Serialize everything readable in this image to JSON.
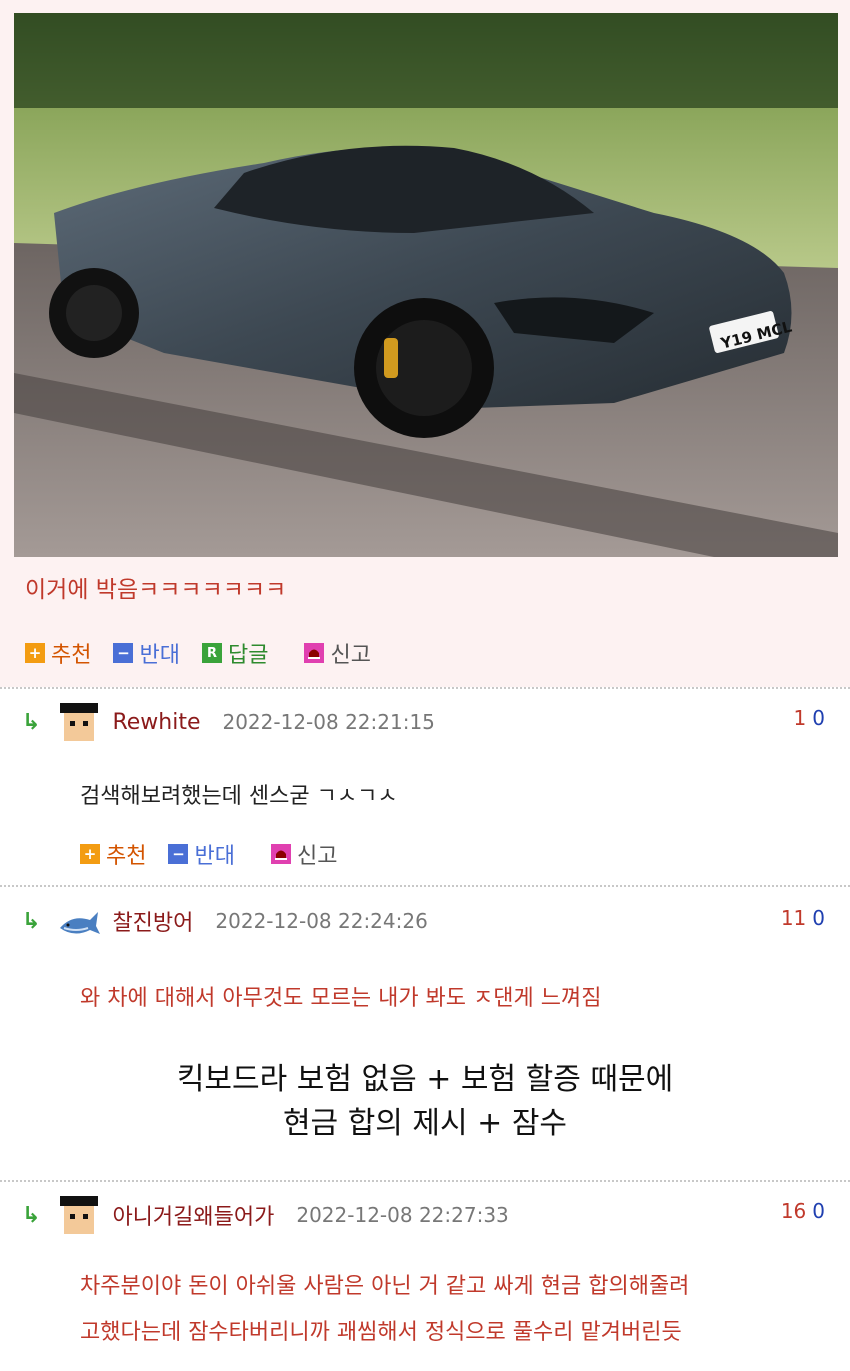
{
  "post": {
    "image_label": "McLaren 720S sports car photo",
    "plate_text": "Y19 MCL",
    "text": "이거에 박음ㅋㅋㅋㅋㅋㅋㅋ",
    "actions": {
      "up": "추천",
      "down": "반대",
      "reply": "답글",
      "report": "신고",
      "reply_badge": "R"
    }
  },
  "comments": [
    {
      "nick": "Rewhite",
      "date": "2022-12-08 22:21:15",
      "up": "1",
      "down": "0",
      "text": "검색해보려했는데 센스굳 ㄱㅅㄱㅅ",
      "actions": {
        "up": "추천",
        "down": "반대",
        "report": "신고"
      }
    },
    {
      "nick": "찰진방어",
      "date": "2022-12-08 22:24:26",
      "up": "11",
      "down": "0",
      "text": "와 차에 대해서 아무것도 모르는 내가 봐도 ㅈ댄게 느껴짐"
    },
    {
      "nick": "아니거길왜들어가",
      "date": "2022-12-08 22:27:33",
      "up": "16",
      "down": "0",
      "text_line1": "차주분이야 돈이 아쉬울 사람은 아닌 거 같고 싸게 현금 합의해줄려",
      "text_line2": "고했다는데 잠수타버리니까 괘씸해서 정식으로 풀수리 맡겨버린듯"
    }
  ],
  "caption": {
    "line1": "킥보드라 보험 없음 + 보험 할증 때문에",
    "line2": "현금 합의 제시 + 잠수"
  },
  "colors": {
    "accent_red": "#c0392b",
    "reply_green": "#3aa33a",
    "down_blue": "#4a6fd6",
    "up_orange": "#f39c12"
  }
}
